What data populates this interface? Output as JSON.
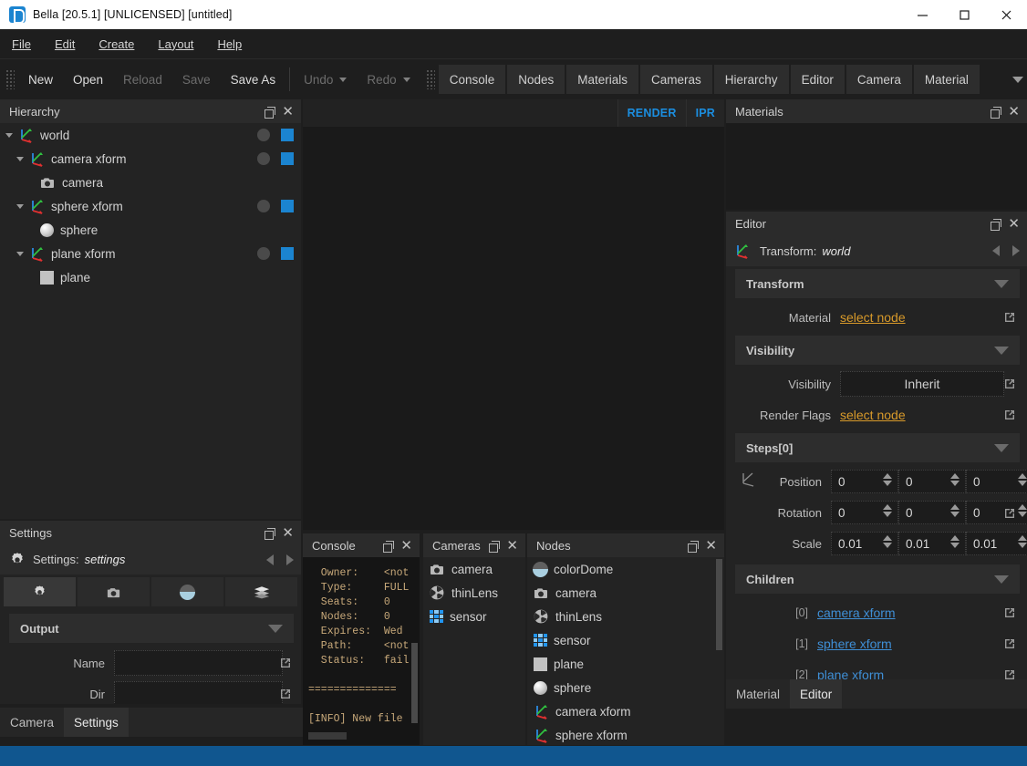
{
  "window": {
    "title": "Bella [20.5.1] [UNLICENSED] [untitled]",
    "logo_name": "bella-logo-icon",
    "minimize": "—",
    "maximize": "□",
    "close": "✕"
  },
  "menubar": {
    "items": [
      {
        "label": "File"
      },
      {
        "label": "Edit"
      },
      {
        "label": "Create"
      },
      {
        "label": "Layout"
      },
      {
        "label": "Help"
      }
    ]
  },
  "toolbar": {
    "buttons": [
      {
        "label": "New",
        "disabled": false
      },
      {
        "label": "Open",
        "disabled": false
      },
      {
        "label": "Reload",
        "disabled": true
      },
      {
        "label": "Save",
        "disabled": true
      },
      {
        "label": "Save As",
        "disabled": false
      }
    ],
    "undo": "Undo",
    "redo": "Redo",
    "view_tabs": [
      "Console",
      "Nodes",
      "Materials",
      "Cameras",
      "Hierarchy",
      "Editor",
      "Camera",
      "Material"
    ],
    "overflow_icon": "chevron-down-icon"
  },
  "hierarchy": {
    "title": "Hierarchy",
    "rows": [
      {
        "label": "world",
        "icon": "axis-icon",
        "depth": 0,
        "expanded": true,
        "has_toggles": true
      },
      {
        "label": "camera xform",
        "icon": "axis-icon",
        "depth": 1,
        "expanded": true,
        "has_toggles": true
      },
      {
        "label": "camera",
        "icon": "camera-icon",
        "depth": 2,
        "expanded": false,
        "has_toggles": false
      },
      {
        "label": "sphere xform",
        "icon": "axis-icon",
        "depth": 1,
        "expanded": true,
        "has_toggles": true
      },
      {
        "label": "sphere",
        "icon": "sphere-icon",
        "depth": 2,
        "expanded": false,
        "has_toggles": false
      },
      {
        "label": "plane xform",
        "icon": "axis-icon",
        "depth": 1,
        "expanded": true,
        "has_toggles": true
      },
      {
        "label": "plane",
        "icon": "plane-icon",
        "depth": 2,
        "expanded": false,
        "has_toggles": false
      }
    ]
  },
  "viewport": {
    "render_button": "RENDER",
    "ipr_button": "IPR"
  },
  "materials": {
    "title": "Materials",
    "items": []
  },
  "editor": {
    "title": "Editor",
    "node_type_label": "Transform:",
    "node_name": "world",
    "sections": {
      "transform": "Transform",
      "visibility": "Visibility",
      "steps": "Steps[0]",
      "children": "Children"
    },
    "material_label": "Material",
    "material_value": "select node",
    "visibility_label": "Visibility",
    "visibility_value": "Inherit",
    "render_flags_label": "Render Flags",
    "render_flags_value": "select node",
    "vectors": [
      {
        "label": "Position",
        "x": "0",
        "y": "0",
        "z": "0"
      },
      {
        "label": "Rotation",
        "x": "0",
        "y": "0",
        "z": "0"
      },
      {
        "label": "Scale",
        "x": "0.01",
        "y": "0.01",
        "z": "0.01"
      }
    ],
    "children": [
      {
        "index": "[0]",
        "name": "camera xform"
      },
      {
        "index": "[1]",
        "name": "sphere xform"
      },
      {
        "index": "[2]",
        "name": "plane xform"
      }
    ],
    "bottom_tabs": [
      {
        "label": "Material",
        "active": false
      },
      {
        "label": "Editor",
        "active": true
      }
    ]
  },
  "settings": {
    "title": "Settings",
    "node_type_label": "Settings:",
    "node_name": "settings",
    "tabs": [
      {
        "icon": "gear-icon",
        "active": true
      },
      {
        "icon": "camera-icon",
        "active": false
      },
      {
        "icon": "dome-icon",
        "active": false
      },
      {
        "icon": "layers-icon",
        "active": false
      }
    ],
    "output_section": "Output",
    "fields": [
      {
        "label": "Name",
        "value": ""
      },
      {
        "label": "Dir",
        "value": ""
      }
    ],
    "bottom_tabs": [
      {
        "label": "Camera",
        "active": false
      },
      {
        "label": "Settings",
        "active": true
      }
    ]
  },
  "console": {
    "title": "Console",
    "text": "  Owner:    <not\n  Type:     FULL\n  Seats:    0\n  Nodes:    0\n  Expires:  Wed\n  Path:     <not\n  Status:   fail\n\n==============\n\n[INFO] New file"
  },
  "cameras": {
    "title": "Cameras",
    "items": [
      {
        "label": "camera",
        "icon": "camera-icon"
      },
      {
        "label": "thinLens",
        "icon": "lens-icon"
      },
      {
        "label": "sensor",
        "icon": "sensor-grid-icon"
      }
    ]
  },
  "nodes": {
    "title": "Nodes",
    "items": [
      {
        "label": "colorDome",
        "icon": "dome-icon"
      },
      {
        "label": "camera",
        "icon": "camera-icon"
      },
      {
        "label": "thinLens",
        "icon": "lens-icon"
      },
      {
        "label": "sensor",
        "icon": "sensor-grid-icon"
      },
      {
        "label": "plane",
        "icon": "plane-icon"
      },
      {
        "label": "sphere",
        "icon": "sphere-icon"
      },
      {
        "label": "camera xform",
        "icon": "axis-icon"
      },
      {
        "label": "sphere xform",
        "icon": "axis-icon"
      }
    ]
  },
  "colors": {
    "accent_blue": "#1b84d0",
    "link_orange": "#d89a2a",
    "link_blue": "#3f8fd6",
    "status_bar": "#10568f",
    "panel_bg": "#232323"
  }
}
